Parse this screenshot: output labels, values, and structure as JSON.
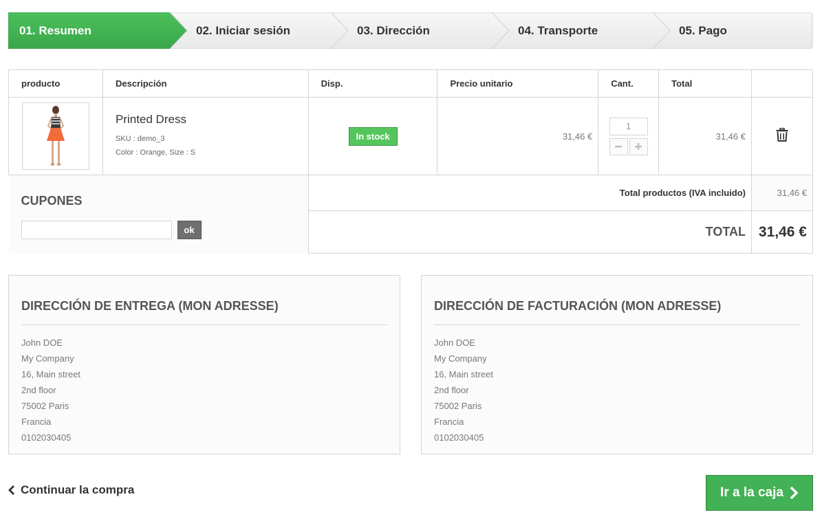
{
  "steps": [
    {
      "label": "01. Resumen",
      "active": true
    },
    {
      "label": "02. Iniciar sesión",
      "active": false
    },
    {
      "label": "03. Dirección",
      "active": false
    },
    {
      "label": "04. Transporte",
      "active": false
    },
    {
      "label": "05. Pago",
      "active": false
    }
  ],
  "table": {
    "headers": [
      "producto",
      "Descripción",
      "Disp.",
      "Precio unitario",
      "Cant.",
      "Total",
      ""
    ],
    "items": [
      {
        "name": "Printed Dress",
        "sku": "SKU : demo_3",
        "attributes": "Color : Orange, Size : S",
        "availability": "In stock",
        "unit_price": "31,46 €",
        "quantity": "1",
        "total": "31,46 €"
      }
    ]
  },
  "coupons": {
    "title": "CUPONES",
    "input_value": "",
    "button": "ok"
  },
  "summary": {
    "products_label": "Total productos (IVA incluido)",
    "products_value": "31,46 €",
    "total_label": "TOTAL",
    "total_value": "31,46 €"
  },
  "delivery_address": {
    "title": "DIRECCIÓN DE ENTREGA (MON ADRESSE)",
    "lines": [
      "John DOE",
      "My Company",
      "16, Main street",
      "2nd floor",
      "75002 Paris",
      "Francia",
      "0102030405"
    ]
  },
  "billing_address": {
    "title": "DIRECCIÓN DE FACTURACIÓN (MON ADRESSE)",
    "lines": [
      "John DOE",
      "My Company",
      "16, Main street",
      "2nd floor",
      "75002 Paris",
      "Francia",
      "0102030405"
    ]
  },
  "actions": {
    "continue": "Continuar la compra",
    "checkout": "Ir a la caja"
  },
  "colors": {
    "accent": "#43b155",
    "stock": "#55c65e"
  }
}
